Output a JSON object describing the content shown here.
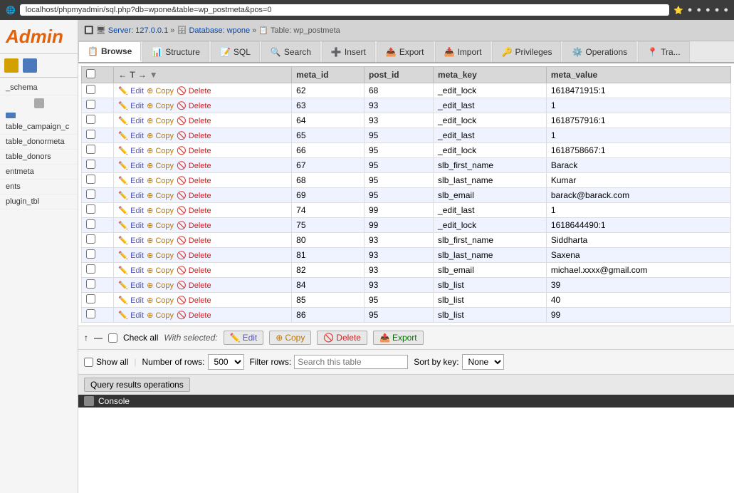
{
  "browser": {
    "url": "localhost/phpmyadmin/sql.php?db=wpone&table=wp_postmeta&pos=0",
    "favicon": "🌐"
  },
  "breadcrumb": {
    "server": "Server: 127.0.0.1",
    "database_label": "Database: wpone",
    "table_label": "Table: wp_postmeta",
    "separator": "»"
  },
  "tabs": [
    {
      "id": "browse",
      "label": "Browse",
      "icon": "📋",
      "active": true
    },
    {
      "id": "structure",
      "label": "Structure",
      "icon": "📊",
      "active": false
    },
    {
      "id": "sql",
      "label": "SQL",
      "icon": "📝",
      "active": false
    },
    {
      "id": "search",
      "label": "Search",
      "icon": "🔍",
      "active": false
    },
    {
      "id": "insert",
      "label": "Insert",
      "icon": "➕",
      "active": false
    },
    {
      "id": "export",
      "label": "Export",
      "icon": "📤",
      "active": false
    },
    {
      "id": "import",
      "label": "Import",
      "icon": "📥",
      "active": false
    },
    {
      "id": "privileges",
      "label": "Privileges",
      "icon": "🔑",
      "active": false
    },
    {
      "id": "operations",
      "label": "Operations",
      "icon": "⚙️",
      "active": false
    },
    {
      "id": "tracking",
      "label": "Tra...",
      "icon": "📍",
      "active": false
    }
  ],
  "table": {
    "columns": [
      {
        "id": "checkbox",
        "label": ""
      },
      {
        "id": "actions",
        "label": ""
      },
      {
        "id": "meta_id",
        "label": "meta_id"
      },
      {
        "id": "post_id",
        "label": "post_id"
      },
      {
        "id": "meta_key",
        "label": "meta_key"
      },
      {
        "id": "meta_value",
        "label": "meta_value"
      }
    ],
    "rows": [
      {
        "meta_id": "62",
        "post_id": "68",
        "meta_key": "_edit_lock",
        "meta_value": "1618471915:1"
      },
      {
        "meta_id": "63",
        "post_id": "93",
        "meta_key": "_edit_last",
        "meta_value": "1"
      },
      {
        "meta_id": "64",
        "post_id": "93",
        "meta_key": "_edit_lock",
        "meta_value": "1618757916:1"
      },
      {
        "meta_id": "65",
        "post_id": "95",
        "meta_key": "_edit_last",
        "meta_value": "1"
      },
      {
        "meta_id": "66",
        "post_id": "95",
        "meta_key": "_edit_lock",
        "meta_value": "1618758667:1"
      },
      {
        "meta_id": "67",
        "post_id": "95",
        "meta_key": "slb_first_name",
        "meta_value": "Barack"
      },
      {
        "meta_id": "68",
        "post_id": "95",
        "meta_key": "slb_last_name",
        "meta_value": "Kumar"
      },
      {
        "meta_id": "69",
        "post_id": "95",
        "meta_key": "slb_email",
        "meta_value": "barack@barack.com"
      },
      {
        "meta_id": "74",
        "post_id": "99",
        "meta_key": "_edit_last",
        "meta_value": "1"
      },
      {
        "meta_id": "75",
        "post_id": "99",
        "meta_key": "_edit_lock",
        "meta_value": "1618644490:1"
      },
      {
        "meta_id": "80",
        "post_id": "93",
        "meta_key": "slb_first_name",
        "meta_value": "Siddharta"
      },
      {
        "meta_id": "81",
        "post_id": "93",
        "meta_key": "slb_last_name",
        "meta_value": "Saxena"
      },
      {
        "meta_id": "82",
        "post_id": "93",
        "meta_key": "slb_email",
        "meta_value": "michael.xxxx@gmail.com"
      },
      {
        "meta_id": "84",
        "post_id": "93",
        "meta_key": "slb_list",
        "meta_value": "39"
      },
      {
        "meta_id": "85",
        "post_id": "95",
        "meta_key": "slb_list",
        "meta_value": "40"
      },
      {
        "meta_id": "86",
        "post_id": "95",
        "meta_key": "slb_list",
        "meta_value": "99"
      }
    ]
  },
  "actions": {
    "edit": "Edit",
    "copy": "Copy",
    "delete": "Delete",
    "export": "Export"
  },
  "bottom_bar": {
    "check_all": "Check all",
    "with_selected": "With selected:",
    "edit_btn": "Edit",
    "copy_btn": "Copy",
    "delete_btn": "Delete",
    "export_btn": "Export"
  },
  "filter_bar": {
    "show_all_label": "Show all",
    "number_of_rows_label": "Number of rows:",
    "number_of_rows_value": "500",
    "filter_rows_label": "Filter rows:",
    "filter_placeholder": "Search this table",
    "sort_by_key_label": "Sort by key:",
    "sort_by_key_value": "None",
    "sort_options": [
      "None"
    ]
  },
  "query_results": {
    "label": "Query results operations"
  },
  "console": {
    "label": "Console"
  },
  "sidebar": {
    "logo": "Admin",
    "nav_items": [
      {
        "label": "_schema"
      },
      {
        "label": "table_campaign_c"
      },
      {
        "label": "table_donormeta"
      },
      {
        "label": "table_donors"
      },
      {
        "label": "entmeta"
      },
      {
        "label": "ents"
      },
      {
        "label": "plugin_tbl"
      }
    ]
  }
}
